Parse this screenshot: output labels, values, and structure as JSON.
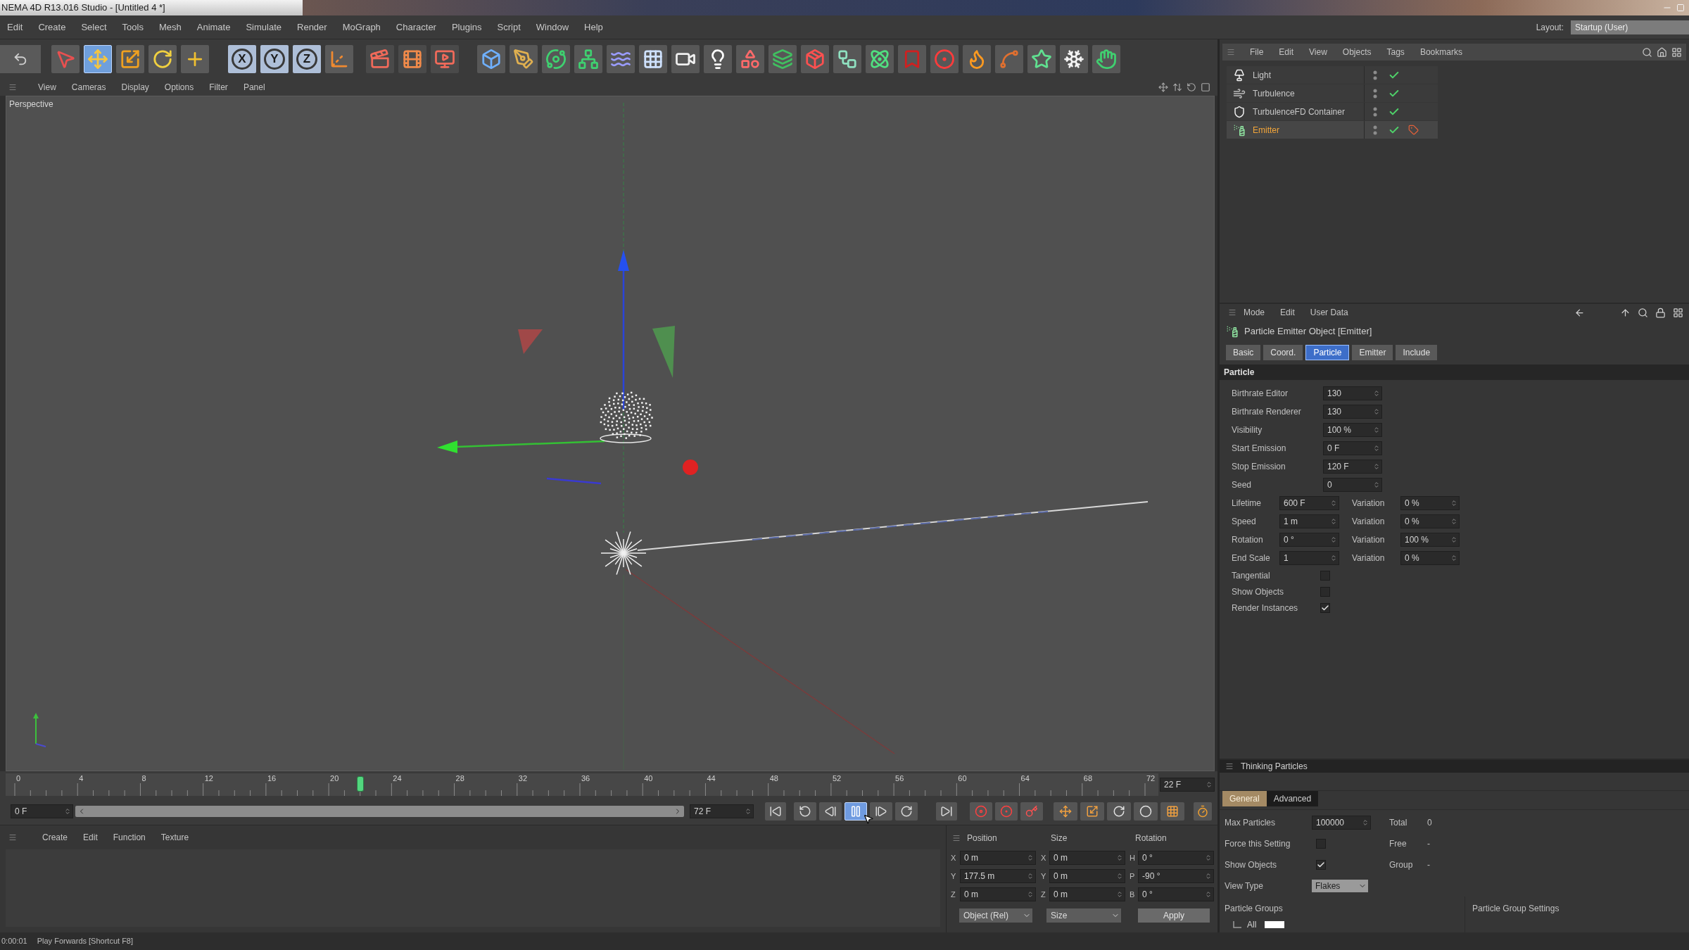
{
  "window": {
    "title": "NEMA 4D R13.016 Studio - [Untitled 4 *]"
  },
  "menu_bar": {
    "items": [
      "Edit",
      "Create",
      "Select",
      "Tools",
      "Mesh",
      "Animate",
      "Simulate",
      "Render",
      "MoGraph",
      "Character",
      "Plugins",
      "Script",
      "Window",
      "Help"
    ],
    "layout_label": "Layout:",
    "layout_value": "Startup (User)"
  },
  "toolbar": {
    "tools": [
      {
        "kind": "pointer",
        "selected": false
      },
      {
        "kind": "move",
        "selected": true
      },
      {
        "kind": "scale",
        "selected": false
      },
      {
        "kind": "rotate",
        "selected": false
      },
      {
        "kind": "add",
        "selected": false
      }
    ],
    "axes": [
      {
        "label": "X",
        "on": true
      },
      {
        "label": "Y",
        "on": true
      },
      {
        "label": "Z",
        "on": true
      }
    ]
  },
  "viewport": {
    "menu": [
      "View",
      "Cameras",
      "Display",
      "Options",
      "Filter",
      "Panel"
    ],
    "camera": "Perspective"
  },
  "timeline": {
    "ticks": [
      "0",
      "4",
      "8",
      "12",
      "16",
      "20",
      "24",
      "28",
      "32",
      "36",
      "40",
      "44",
      "48",
      "52",
      "56",
      "60",
      "64",
      "68",
      "72"
    ],
    "current_frame": "22 F",
    "playhead": {
      "level": 0.306
    },
    "start_field": "0 F",
    "end_field": "72 F",
    "playing": true
  },
  "material_manager": {
    "menu": [
      "Create",
      "Edit",
      "Function",
      "Texture"
    ]
  },
  "coordinates": {
    "columns": [
      "Position",
      "Size",
      "Rotation"
    ],
    "rows": [
      {
        "cells": [
          {
            "axis": "X",
            "value": "0 m"
          },
          {
            "axis": "X",
            "value": "0 m"
          },
          {
            "axis": "H",
            "value": "0 °"
          }
        ]
      },
      {
        "cells": [
          {
            "axis": "Y",
            "value": "177.5 m"
          },
          {
            "axis": "Y",
            "value": "0 m"
          },
          {
            "axis": "P",
            "value": "-90 °"
          }
        ]
      },
      {
        "cells": [
          {
            "axis": "Z",
            "value": "0 m"
          },
          {
            "axis": "Z",
            "value": "0 m"
          },
          {
            "axis": "B",
            "value": "0 °"
          }
        ]
      }
    ],
    "mode": "Object (Rel)",
    "size_mode": "Size",
    "apply": "Apply"
  },
  "object_manager": {
    "menu": [
      "File",
      "Edit",
      "View",
      "Objects",
      "Tags",
      "Bookmarks"
    ],
    "objects": [
      {
        "name": "Light",
        "kind": "light",
        "selected": false,
        "enabled": true,
        "has_tag": false
      },
      {
        "name": "Turbulence",
        "kind": "modifier",
        "selected": false,
        "enabled": true,
        "has_tag": false
      },
      {
        "name": "TurbulenceFD Container",
        "kind": "container",
        "selected": false,
        "enabled": true,
        "has_tag": false
      },
      {
        "name": "Emitter",
        "kind": "emitter",
        "selected": true,
        "enabled": true,
        "has_tag": true
      }
    ]
  },
  "attributes": {
    "menu": [
      "Mode",
      "Edit",
      "User Data"
    ],
    "title": "Particle Emitter Object [Emitter]",
    "tabs": [
      {
        "label": "Basic",
        "selected": false
      },
      {
        "label": "Coord.",
        "selected": false
      },
      {
        "label": "Particle",
        "selected": true
      },
      {
        "label": "Emitter",
        "selected": false
      },
      {
        "label": "Include",
        "selected": false
      }
    ],
    "section": "Particle",
    "params": [
      {
        "kind": "field",
        "label": "Birthrate Editor",
        "value": "130"
      },
      {
        "kind": "field",
        "label": "Birthrate Renderer",
        "value": "130"
      },
      {
        "kind": "field",
        "label": "Visibility",
        "value": "100 %"
      },
      {
        "kind": "field",
        "label": "Start Emission",
        "value": "0 F"
      },
      {
        "kind": "field",
        "label": "Stop Emission",
        "value": "120 F"
      },
      {
        "kind": "field",
        "label": "Seed",
        "value": "0"
      },
      {
        "kind": "pair",
        "label": "Lifetime",
        "value": "600 F",
        "label_2": "Variation",
        "value_2": "0 %"
      },
      {
        "kind": "pair",
        "label": "Speed",
        "value": "1 m",
        "label_2": "Variation",
        "value_2": "0 %"
      },
      {
        "kind": "pair",
        "label": "Rotation",
        "value": "0 °",
        "label_2": "Variation",
        "value_2": "100 %"
      },
      {
        "kind": "pair",
        "label": "End Scale",
        "value": "1",
        "label_2": "Variation",
        "value_2": "0 %"
      },
      {
        "kind": "checkbox",
        "label": "Tangential",
        "checked": false
      },
      {
        "kind": "checkbox",
        "label": "Show Objects",
        "checked": false
      },
      {
        "kind": "checkbox",
        "label": "Render Instances",
        "checked": true
      }
    ]
  },
  "thinking_particles": {
    "title": "Thinking Particles",
    "tabs": [
      {
        "label": "General",
        "selected": true
      },
      {
        "label": "Advanced",
        "selected": false
      }
    ],
    "settings": [
      {
        "kind": "field",
        "label": "Max Particles",
        "value": "100000",
        "info_label": "Total",
        "info_value": "0"
      },
      {
        "kind": "checkbox",
        "label": "Force this Setting",
        "checked": false,
        "info_label": "Free",
        "info_value": "-"
      },
      {
        "kind": "checkbox",
        "label": "Show Objects",
        "checked": true,
        "info_label": "Group",
        "info_value": "-"
      },
      {
        "kind": "dropdown",
        "label": "View Type",
        "value": "Flakes"
      }
    ],
    "groups_label": "Particle Groups",
    "groups": [
      {
        "name": "All",
        "color": "#ffffff"
      }
    ],
    "group_settings_label": "Particle Group Settings"
  },
  "status_bar": {
    "time": "0:00:01",
    "message": "Play Forwards [Shortcut F8]"
  }
}
